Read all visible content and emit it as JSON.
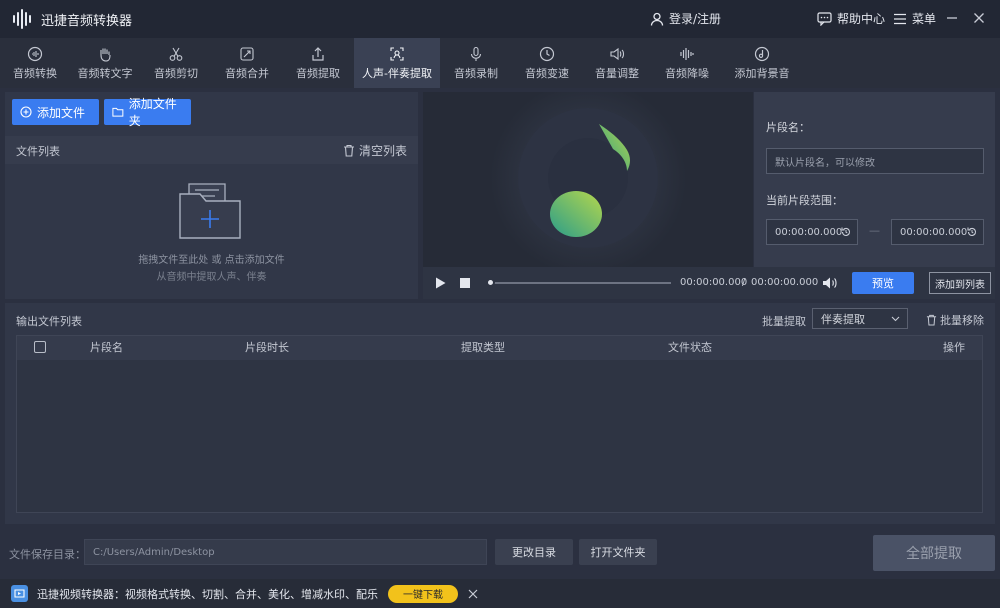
{
  "app": {
    "title": "迅捷音频转换器"
  },
  "header": {
    "login": "登录/注册",
    "help": "帮助中心",
    "menu": "菜单"
  },
  "tabs": [
    {
      "label": "音频转换",
      "icon": "audio-convert-icon"
    },
    {
      "label": "音频转文字",
      "icon": "hand-icon"
    },
    {
      "label": "音频剪切",
      "icon": "scissors-icon"
    },
    {
      "label": "音频合并",
      "icon": "merge-icon"
    },
    {
      "label": "音频提取",
      "icon": "upload-icon"
    },
    {
      "label": "人声-伴奏提取",
      "icon": "vocal-icon"
    },
    {
      "label": "音频录制",
      "icon": "microphone-icon"
    },
    {
      "label": "音频变速",
      "icon": "speed-icon"
    },
    {
      "label": "音量调整",
      "icon": "volume-icon"
    },
    {
      "label": "音频降噪",
      "icon": "noise-icon"
    },
    {
      "label": "添加背景音",
      "icon": "music-note-icon"
    }
  ],
  "active_tab": "人声-伴奏提取",
  "files": {
    "add_file": "添加文件",
    "add_folder": "添加文件夹",
    "list_title": "文件列表",
    "clear_list": "清空列表",
    "drop_hint1": "拖拽文件至此处 或 点击添加文件",
    "drop_hint2": "从音频中提取人声、伴奏"
  },
  "player": {
    "current_time": "00:00:00.000",
    "separator": "/",
    "total_time": "00:00:00.000",
    "preview": "预览",
    "add_to_list": "添加到列表"
  },
  "segment": {
    "name_label": "片段名：",
    "name_placeholder": "默认片段名，可以修改",
    "range_label": "当前片段范围：",
    "start": "00:00:00.000",
    "range_sep": "—",
    "end": "00:00:00.000"
  },
  "output": {
    "title": "输出文件列表",
    "batch_extract_label": "批量提取",
    "batch_extract_value": "伴奏提取",
    "batch_remove": "批量移除",
    "columns": [
      "片段名",
      "片段时长",
      "提取类型",
      "文件状态",
      "操作"
    ]
  },
  "save": {
    "label": "文件保存目录：",
    "path": "C:/Users/Admin/Desktop",
    "change_dir": "更改目录",
    "open_folder": "打开文件夹",
    "extract_all": "全部提取"
  },
  "promo": {
    "text": "迅捷视频转换器：视频格式转换、切割、合并、美化、增减水印、配乐",
    "download": "一键下载"
  }
}
